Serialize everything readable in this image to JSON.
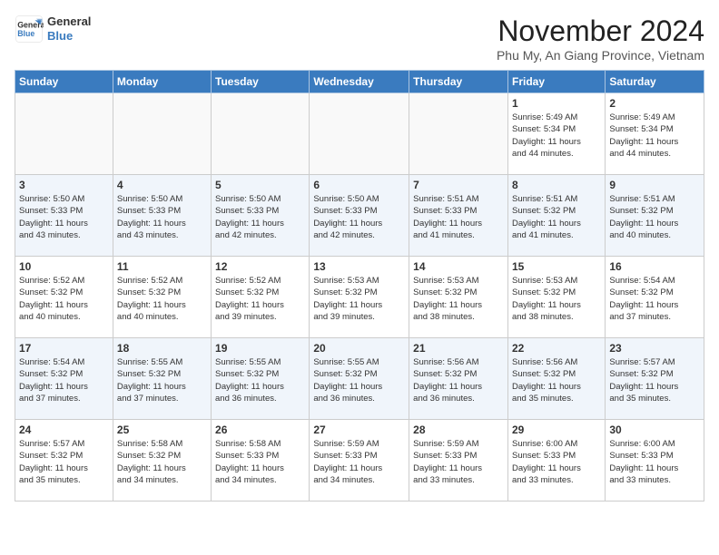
{
  "header": {
    "logo_line1": "General",
    "logo_line2": "Blue",
    "month": "November 2024",
    "location": "Phu My, An Giang Province, Vietnam"
  },
  "weekdays": [
    "Sunday",
    "Monday",
    "Tuesday",
    "Wednesday",
    "Thursday",
    "Friday",
    "Saturday"
  ],
  "weeks": [
    [
      {
        "day": "",
        "info": ""
      },
      {
        "day": "",
        "info": ""
      },
      {
        "day": "",
        "info": ""
      },
      {
        "day": "",
        "info": ""
      },
      {
        "day": "",
        "info": ""
      },
      {
        "day": "1",
        "info": "Sunrise: 5:49 AM\nSunset: 5:34 PM\nDaylight: 11 hours\nand 44 minutes."
      },
      {
        "day": "2",
        "info": "Sunrise: 5:49 AM\nSunset: 5:34 PM\nDaylight: 11 hours\nand 44 minutes."
      }
    ],
    [
      {
        "day": "3",
        "info": "Sunrise: 5:50 AM\nSunset: 5:33 PM\nDaylight: 11 hours\nand 43 minutes."
      },
      {
        "day": "4",
        "info": "Sunrise: 5:50 AM\nSunset: 5:33 PM\nDaylight: 11 hours\nand 43 minutes."
      },
      {
        "day": "5",
        "info": "Sunrise: 5:50 AM\nSunset: 5:33 PM\nDaylight: 11 hours\nand 42 minutes."
      },
      {
        "day": "6",
        "info": "Sunrise: 5:50 AM\nSunset: 5:33 PM\nDaylight: 11 hours\nand 42 minutes."
      },
      {
        "day": "7",
        "info": "Sunrise: 5:51 AM\nSunset: 5:33 PM\nDaylight: 11 hours\nand 41 minutes."
      },
      {
        "day": "8",
        "info": "Sunrise: 5:51 AM\nSunset: 5:32 PM\nDaylight: 11 hours\nand 41 minutes."
      },
      {
        "day": "9",
        "info": "Sunrise: 5:51 AM\nSunset: 5:32 PM\nDaylight: 11 hours\nand 40 minutes."
      }
    ],
    [
      {
        "day": "10",
        "info": "Sunrise: 5:52 AM\nSunset: 5:32 PM\nDaylight: 11 hours\nand 40 minutes."
      },
      {
        "day": "11",
        "info": "Sunrise: 5:52 AM\nSunset: 5:32 PM\nDaylight: 11 hours\nand 40 minutes."
      },
      {
        "day": "12",
        "info": "Sunrise: 5:52 AM\nSunset: 5:32 PM\nDaylight: 11 hours\nand 39 minutes."
      },
      {
        "day": "13",
        "info": "Sunrise: 5:53 AM\nSunset: 5:32 PM\nDaylight: 11 hours\nand 39 minutes."
      },
      {
        "day": "14",
        "info": "Sunrise: 5:53 AM\nSunset: 5:32 PM\nDaylight: 11 hours\nand 38 minutes."
      },
      {
        "day": "15",
        "info": "Sunrise: 5:53 AM\nSunset: 5:32 PM\nDaylight: 11 hours\nand 38 minutes."
      },
      {
        "day": "16",
        "info": "Sunrise: 5:54 AM\nSunset: 5:32 PM\nDaylight: 11 hours\nand 37 minutes."
      }
    ],
    [
      {
        "day": "17",
        "info": "Sunrise: 5:54 AM\nSunset: 5:32 PM\nDaylight: 11 hours\nand 37 minutes."
      },
      {
        "day": "18",
        "info": "Sunrise: 5:55 AM\nSunset: 5:32 PM\nDaylight: 11 hours\nand 37 minutes."
      },
      {
        "day": "19",
        "info": "Sunrise: 5:55 AM\nSunset: 5:32 PM\nDaylight: 11 hours\nand 36 minutes."
      },
      {
        "day": "20",
        "info": "Sunrise: 5:55 AM\nSunset: 5:32 PM\nDaylight: 11 hours\nand 36 minutes."
      },
      {
        "day": "21",
        "info": "Sunrise: 5:56 AM\nSunset: 5:32 PM\nDaylight: 11 hours\nand 36 minutes."
      },
      {
        "day": "22",
        "info": "Sunrise: 5:56 AM\nSunset: 5:32 PM\nDaylight: 11 hours\nand 35 minutes."
      },
      {
        "day": "23",
        "info": "Sunrise: 5:57 AM\nSunset: 5:32 PM\nDaylight: 11 hours\nand 35 minutes."
      }
    ],
    [
      {
        "day": "24",
        "info": "Sunrise: 5:57 AM\nSunset: 5:32 PM\nDaylight: 11 hours\nand 35 minutes."
      },
      {
        "day": "25",
        "info": "Sunrise: 5:58 AM\nSunset: 5:32 PM\nDaylight: 11 hours\nand 34 minutes."
      },
      {
        "day": "26",
        "info": "Sunrise: 5:58 AM\nSunset: 5:33 PM\nDaylight: 11 hours\nand 34 minutes."
      },
      {
        "day": "27",
        "info": "Sunrise: 5:59 AM\nSunset: 5:33 PM\nDaylight: 11 hours\nand 34 minutes."
      },
      {
        "day": "28",
        "info": "Sunrise: 5:59 AM\nSunset: 5:33 PM\nDaylight: 11 hours\nand 33 minutes."
      },
      {
        "day": "29",
        "info": "Sunrise: 6:00 AM\nSunset: 5:33 PM\nDaylight: 11 hours\nand 33 minutes."
      },
      {
        "day": "30",
        "info": "Sunrise: 6:00 AM\nSunset: 5:33 PM\nDaylight: 11 hours\nand 33 minutes."
      }
    ]
  ]
}
